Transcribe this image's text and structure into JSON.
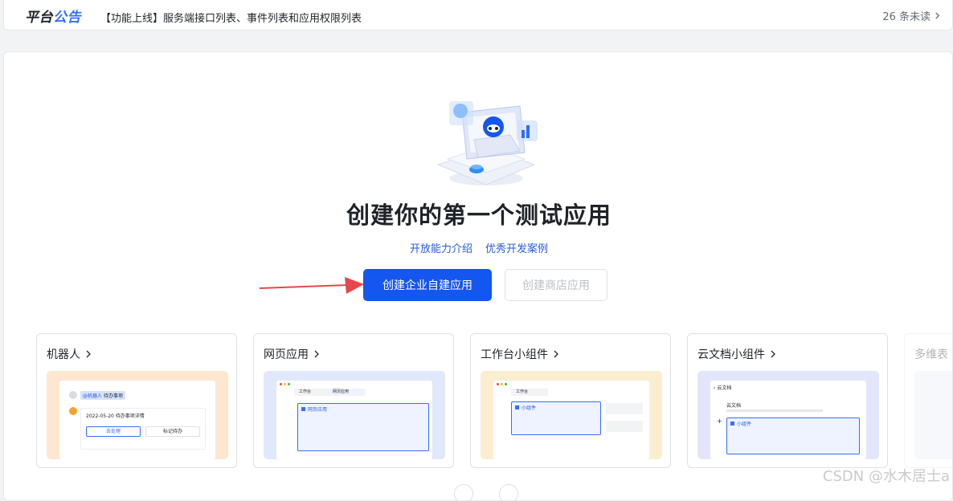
{
  "announcement": {
    "brand_part1": "平台",
    "brand_part2": "公告",
    "notice": "【功能上线】服务端接口列表、事件列表和应用权限列表",
    "unread": "26 条未读"
  },
  "main": {
    "title": "创建你的第一个测试应用",
    "links": [
      "开放能力介绍",
      "优秀开发案例"
    ],
    "primary_button": "创建企业自建应用",
    "secondary_button": "创建商店应用"
  },
  "cards": [
    {
      "title": "机器人",
      "preview": {
        "tag": "@机器人",
        "tag_text": "待办事项",
        "date_line": "2022-05-20 待办事项详情",
        "btn1": "去处理",
        "btn2": "标记待办"
      }
    },
    {
      "title": "网页应用",
      "preview": {
        "tab1": "工作台",
        "tab2": "网页应用",
        "box_label": "网页应用"
      }
    },
    {
      "title": "工作台小组件",
      "preview": {
        "tab1": "工作台",
        "box_label": "小组件"
      }
    },
    {
      "title": "云文档小组件",
      "preview": {
        "header": "云文档",
        "doc_title": "云文档",
        "box_label": "小组件"
      }
    },
    {
      "title": "多维表",
      "preview": {}
    }
  ],
  "colors": {
    "accent": "#1456f0",
    "link": "#245bdb",
    "card1_bg": "#fde7cf",
    "card2_bg": "#e1e8fb",
    "card3_bg": "#fbeed0",
    "card4_bg": "#e3e6fb"
  },
  "watermark": "CSDN @水木居士a"
}
